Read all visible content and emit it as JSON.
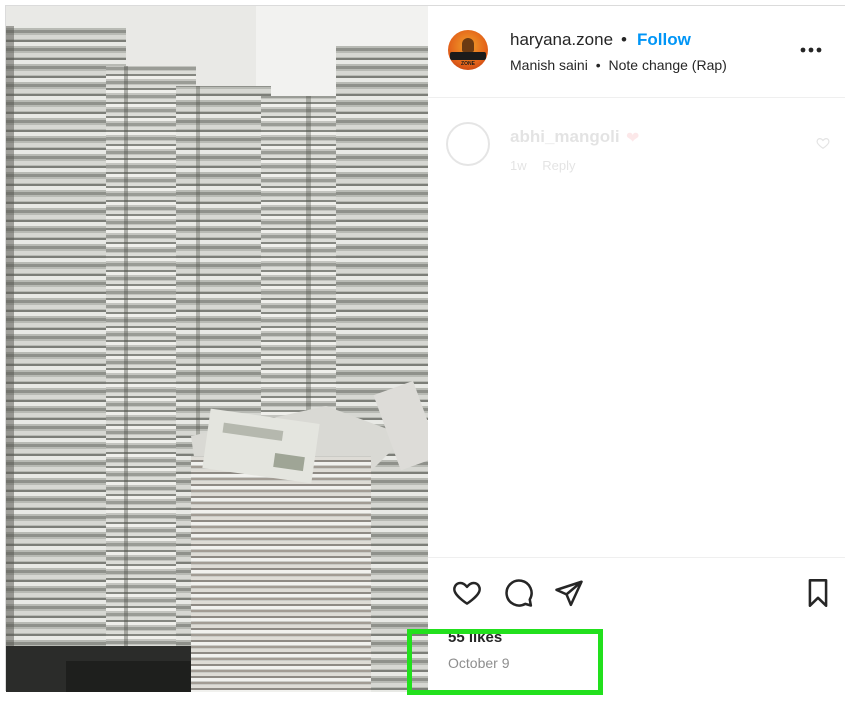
{
  "post": {
    "username": "haryana.zone",
    "separator": "•",
    "follow_label": "Follow",
    "audio_artist": "Manish saini",
    "audio_title": "Note change (Rap)",
    "avatar_text": "ZONE",
    "more_icon": "more-horizontal-icon"
  },
  "comment": {
    "username": "abhi_mangoli",
    "age": "1w",
    "reply_label": "Reply"
  },
  "actions": {
    "like_icon": "heart-icon",
    "comment_icon": "comment-icon",
    "share_icon": "paper-plane-icon",
    "save_icon": "bookmark-icon"
  },
  "stats": {
    "likes": "55 likes",
    "date": "October 9"
  },
  "colors": {
    "link": "#0095f6",
    "text": "#262626",
    "muted": "#8e8e8e",
    "highlight": "#22e01d"
  }
}
